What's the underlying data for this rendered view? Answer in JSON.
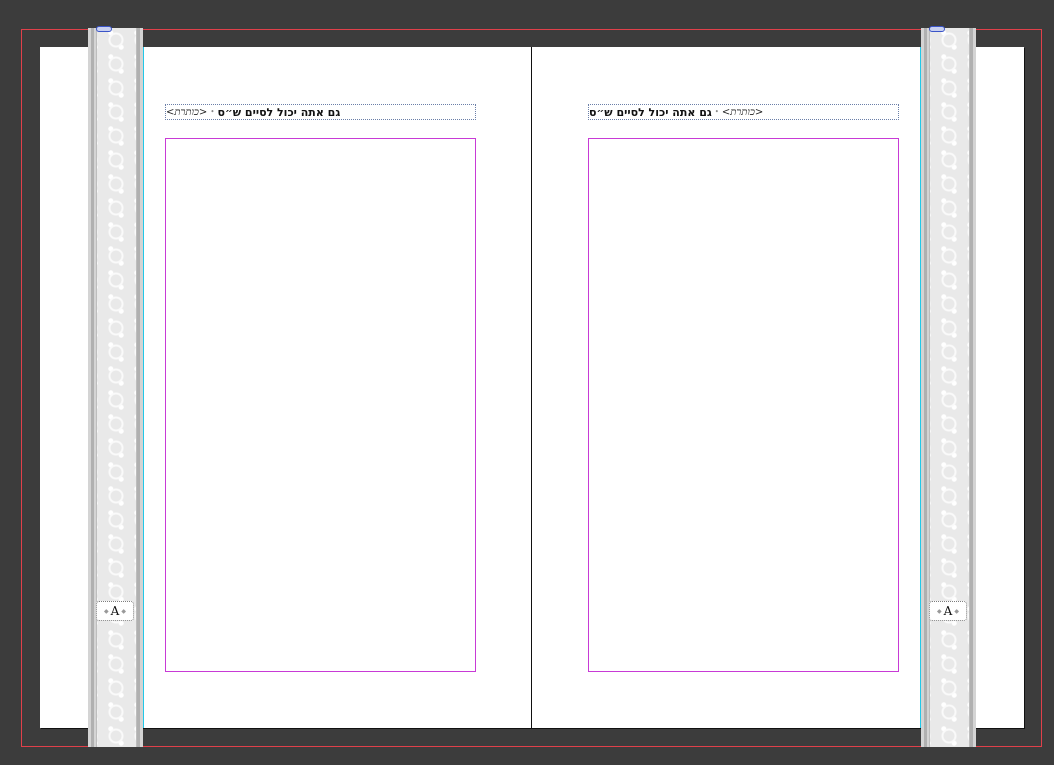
{
  "document": {
    "left_page": {
      "header_text": "גם אתה יכול לסיים ש״ס",
      "header_variable": "<כותרת>"
    },
    "right_page": {
      "header_text": "גם אתה יכול לסיים ש״ס",
      "header_variable": "<כותרת>"
    },
    "parent_badge_left": "A",
    "parent_badge_right": "A"
  },
  "colors": {
    "pasteboard": "#3c3c3c",
    "page": "#ffffff",
    "bleed_guide": "#e0404a",
    "margin_guide": "#c83ad6",
    "column_guide": "#22c8e8",
    "frame_edge": "#6b7fa8"
  },
  "icons": {
    "linked_frame": "link-icon",
    "page_separator": "diamond-dot"
  }
}
